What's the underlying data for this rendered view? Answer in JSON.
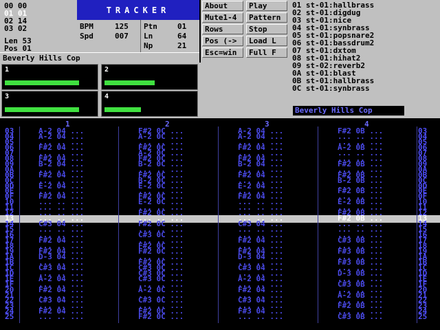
{
  "positions": {
    "lines": [
      "00 00",
      "01 01",
      "02 14",
      "03 02"
    ],
    "active_index": 1,
    "len": "Len 53",
    "pos": "Pos 01"
  },
  "title": "TRACKER",
  "stats": {
    "bpm_label": "BPM",
    "bpm_value": "125",
    "spd_label": "Spd",
    "spd_value": "007",
    "ptn_label": "Ptn",
    "ptn_value": "01",
    "ln_label": "Ln",
    "ln_value": "64",
    "np_label": "Np",
    "np_value": "21"
  },
  "song_name": "Beverly Hills Cop",
  "scopes": [
    {
      "num": "1",
      "level": 0.82
    },
    {
      "num": "2",
      "level": 0.55
    },
    {
      "num": "3",
      "level": 0.82
    },
    {
      "num": "4",
      "level": 0.4
    }
  ],
  "buttons": {
    "about": "About",
    "play": "Play",
    "mute": "Mute1-4",
    "pattern": "Pattern",
    "rows": "Rows",
    "stop": "Stop",
    "pos": "Pos (->",
    "load": "Load L",
    "esc": "Esc=win",
    "full": "Full F"
  },
  "samples": [
    "01 st-01:hallbrass",
    "02 st-01:digdug",
    "03 st-01:nice",
    "04 st-01:synbrass",
    "05 st-01:popsnare2",
    "06 st-01:bassdrum2",
    "07 st-01:dxtom",
    "08 st-01:hihat2",
    "09 st-02:reverb2",
    "0A st-01:blast",
    "0B st-01:hallbrass",
    "0C st-01:synbrass"
  ],
  "sample_name_field": "Beverly Hills Cop",
  "channel_headers": [
    "1",
    "2",
    "3",
    "4"
  ],
  "colors": {
    "accent": "#2020c0",
    "pattern_text": "#4a4ae8",
    "scope_bar": "#40e040"
  },
  "rows": [
    "03",
    "04",
    "05",
    "06",
    "07",
    "08",
    "09",
    "0A",
    "0B",
    "0C",
    "0D",
    "0E",
    "0F",
    "10",
    "11",
    "12",
    "13",
    "14",
    "15",
    "16",
    "17",
    "18",
    "19",
    "1A",
    "1B",
    "1C",
    "1D",
    "1E",
    "1F",
    "20",
    "21",
    "22",
    "23",
    "24",
    "25"
  ],
  "cursor_row": "13",
  "pattern": [
    [
      "A-2 04",
      "F#2 0C",
      "A-2 04",
      "F#2 0B"
    ],
    [
      "A-2 04",
      "A-2 0C",
      "A-2 04",
      "... .."
    ],
    [
      "... ..",
      "... ..",
      "... ..",
      "... .."
    ],
    [
      "F#2 04",
      "F#2 0C",
      "F#2 04",
      "A-2 0B"
    ],
    [
      "... ..",
      "A-2 0C",
      "... ..",
      "... .."
    ],
    [
      "F#2 04",
      "F#2 0C",
      "F#2 04",
      "... .."
    ],
    [
      "B-2 04",
      "B-2 0C",
      "B-2 04",
      "F#2 0B"
    ],
    [
      "... ..",
      "... ..",
      "... ..",
      "... .."
    ],
    [
      "F#2 04",
      "F#2 0C",
      "F#2 04",
      "F#2 0B"
    ],
    [
      "... ..",
      "B-2 0C",
      "... ..",
      "B-2 0B"
    ],
    [
      "E-2 04",
      "E-2 0C",
      "E-2 04",
      "... .."
    ],
    [
      "... ..",
      "... ..",
      "... ..",
      "F#2 0B"
    ],
    [
      "F#2 04",
      "F#2 0C",
      "F#2 04",
      "... .."
    ],
    [
      "... ..",
      "E-2 0C",
      "... ..",
      "E-2 0B"
    ],
    [
      "... ..",
      "... ..",
      "... ..",
      "... .."
    ],
    [
      "... ..",
      "F#2 0C",
      "... ..",
      "F#2 0B"
    ],
    [
      "... ..",
      "... ..",
      "... ..",
      "F#2 0B"
    ],
    [
      "C#3 04",
      "F#2 0C",
      "C#3 04",
      "... .."
    ],
    [
      "... ..",
      "... ..",
      "... ..",
      "... .."
    ],
    [
      "... ..",
      "C#3 0C",
      "... ..",
      "... .."
    ],
    [
      "F#2 04",
      "... ..",
      "F#2 04",
      "C#3 0B"
    ],
    [
      "... ..",
      "F#2 0C",
      "... ..",
      "... .."
    ],
    [
      "F#2 04",
      "F#2 0C",
      "F#2 04",
      "F#3 0B"
    ],
    [
      "D-3 04",
      "... ..",
      "D-3 04",
      "... .."
    ],
    [
      "... ..",
      "F#2 0C",
      "... ..",
      "F#3 0B"
    ],
    [
      "C#3 04",
      "C#3 0C",
      "C#3 04",
      "... .."
    ],
    [
      "... ..",
      "C#3 0C",
      "... ..",
      "D-3 0B"
    ],
    [
      "A-2 04",
      "C#3 0C",
      "A-2 04",
      "... .."
    ],
    [
      "... ..",
      "... ..",
      "... ..",
      "C#3 0B"
    ],
    [
      "F#2 04",
      "A-2 0C",
      "F#2 04",
      "... .."
    ],
    [
      "... ..",
      "... ..",
      "... ..",
      "A-2 0B"
    ],
    [
      "C#3 04",
      "C#3 0C",
      "C#3 04",
      "... .."
    ],
    [
      "... ..",
      "... ..",
      "... ..",
      "F#2 0B"
    ],
    [
      "F#2 04",
      "F#2 0C",
      "F#3 04",
      "... .."
    ],
    [
      "... ..",
      "F#2 0C",
      "... ..",
      "C#3 0B"
    ]
  ]
}
